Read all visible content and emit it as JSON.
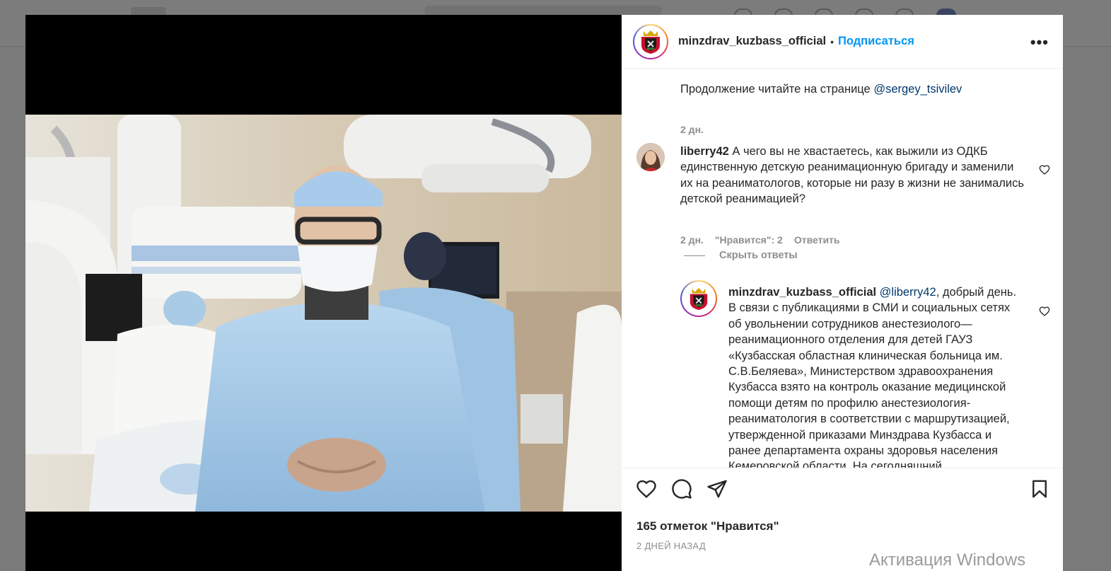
{
  "post": {
    "author": "minzdrav_kuzbass_official",
    "separator": "•",
    "follow_label": "Подписаться",
    "more_icon": "more-horizontal-icon",
    "caption": {
      "text": "Продолжение читайте на странице ",
      "mention": "@sergey_tsivilev",
      "time": "2 дн."
    },
    "comments": [
      {
        "user": "liberry42",
        "text": "А чего вы не хвастаетесь, как выжили из ОДКБ единственную детскую реанимационную бригаду и заменили их на реаниматологов, которые ни разу в жизни не занимались детской реанимацией?",
        "time": "2 дн.",
        "likes": "\"Нравится\": 2",
        "reply_label": "Ответить",
        "hide_replies_label": "Скрыть ответы",
        "replies": [
          {
            "user": "minzdrav_kuzbass_official",
            "mention": "@liberry42",
            "text": ", добрый день. В связи с публикациями в СМИ и социальных сетях об увольнении сотрудников анестезиолого—реанимационного отделения для детей ГАУЗ «Кузбасская областная клиническая больница им. С.В.Беляева», Министерством здравоохранения Кузбасса взято на контроль оказание медицинской помощи детям по профилю анестезиология-реаниматология в соответствии с маршрутизацией, утвержденной приказами Минздрава Кузбасса и ранее департамента охраны здоровья населения Кемеровской области. На сегодняшний"
          }
        ]
      }
    ],
    "likes_count": "165 отметок \"Нравится\"",
    "date": "2 ДНЕЙ НАЗАД"
  },
  "colors": {
    "follow": "#0095f6",
    "link": "#00376b",
    "muted": "#8e8e8e"
  },
  "watermark": "Активация Windows"
}
